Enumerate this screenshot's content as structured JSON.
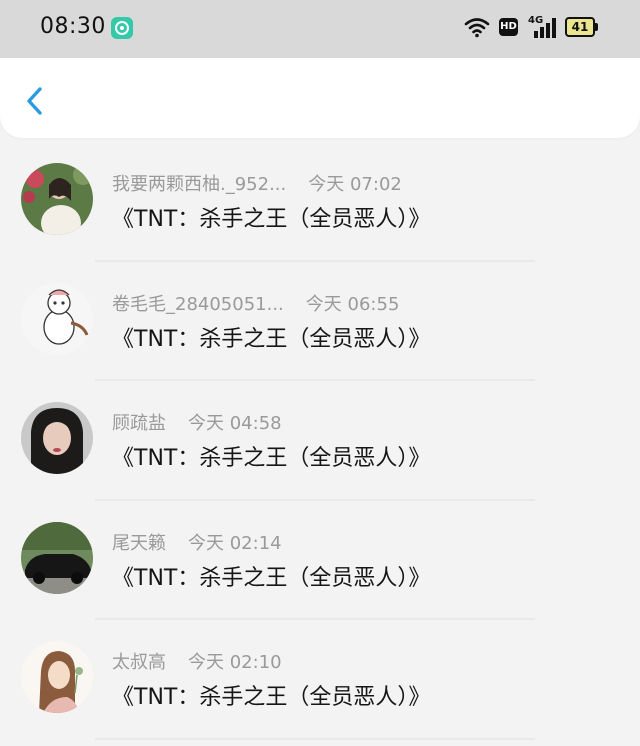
{
  "status_bar": {
    "time": "08:30",
    "network_badge": "HD",
    "signal_type": "4G",
    "battery_level": "41",
    "battery_color": "#ece58f"
  },
  "header": {
    "back_icon": "chevron-left-icon",
    "accent_color": "#2a9bde"
  },
  "messages": [
    {
      "name": "我要两颗西柚._952...",
      "time": "今天 07:02",
      "text": "《TNT：杀手之王（全员恶人）》"
    },
    {
      "name": "卷毛毛_28405051...",
      "time": "今天 06:55",
      "text": "《TNT：杀手之王（全员恶人）》"
    },
    {
      "name": "顾疏盐",
      "time": "今天 04:58",
      "text": "《TNT：杀手之王（全员恶人）》"
    },
    {
      "name": "尾天籁",
      "time": "今天 02:14",
      "text": "《TNT：杀手之王（全员恶人）》"
    },
    {
      "name": "太叔高",
      "time": "今天 02:10",
      "text": "《TNT：杀手之王（全员恶人）》"
    }
  ]
}
